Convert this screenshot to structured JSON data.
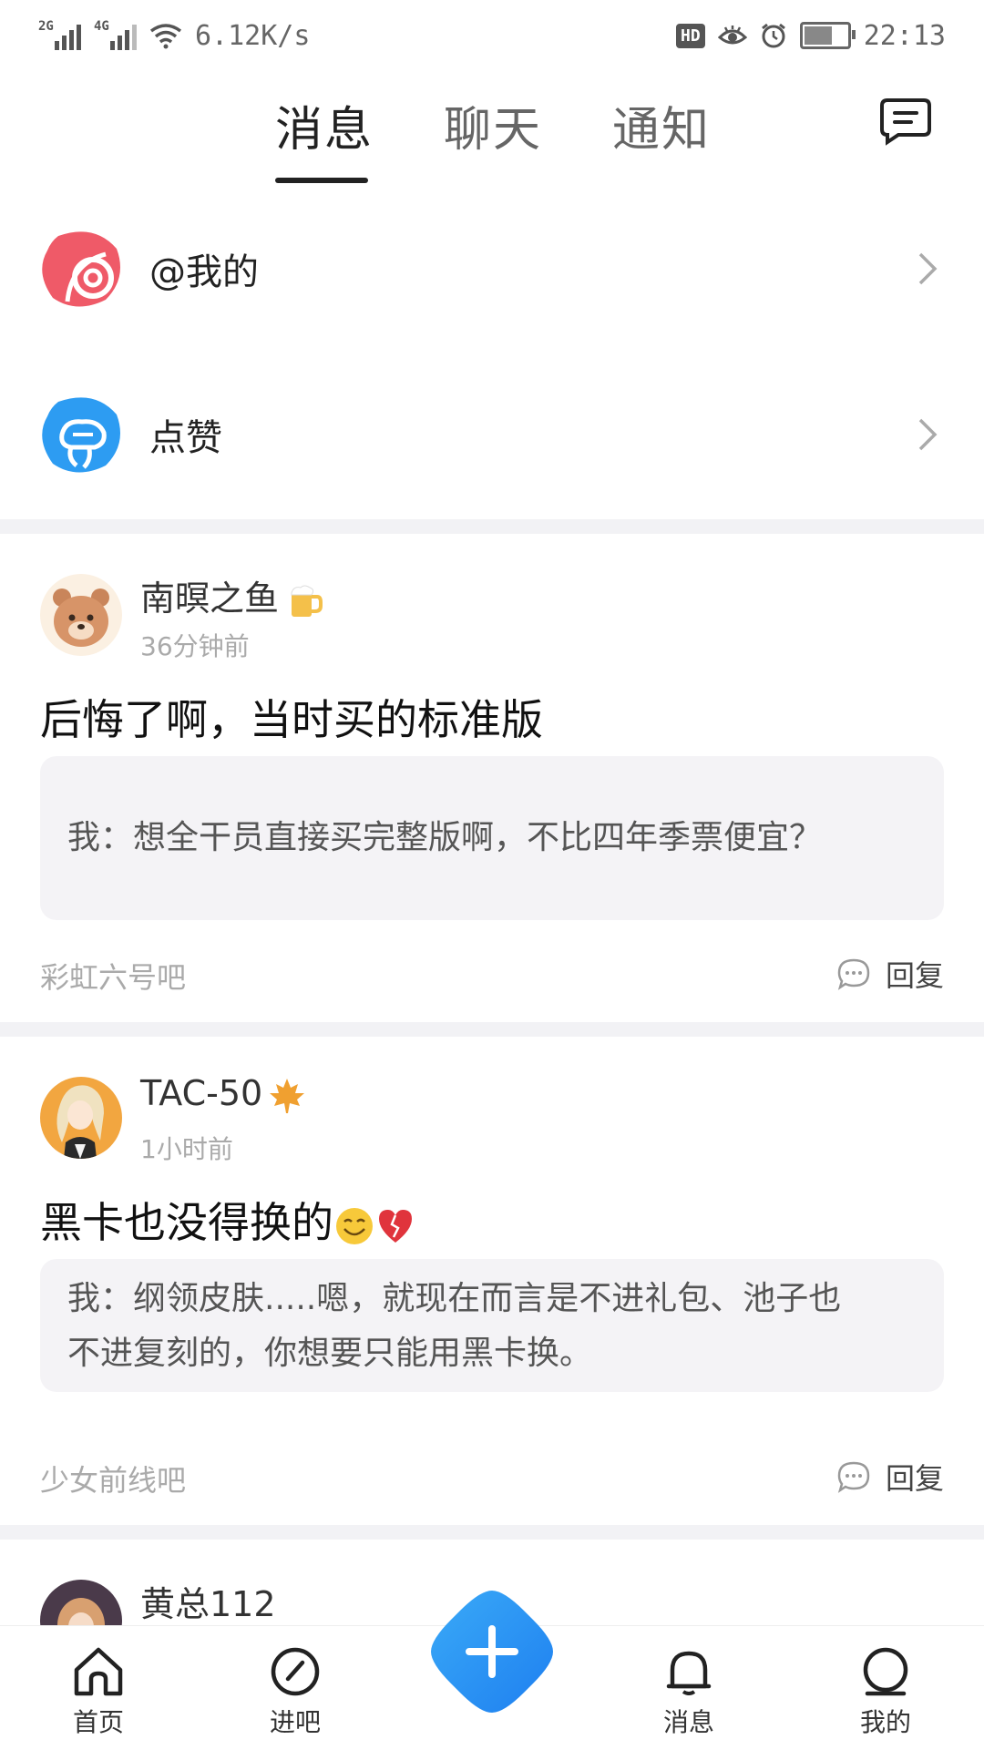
{
  "status_bar": {
    "net1": "2G",
    "net2": "4G",
    "speed": "6.12K/s",
    "hd": "HD",
    "time": "22:13"
  },
  "tabs": [
    {
      "label": "消息"
    },
    {
      "label": "聊天"
    },
    {
      "label": "通知"
    }
  ],
  "entries": [
    {
      "label": "@我的"
    },
    {
      "label": "点赞"
    }
  ],
  "posts": [
    {
      "user": "南暝之鱼",
      "time": "36分钟前",
      "title": "后悔了啊，当时买的标准版",
      "quote": "我：想全干员直接买完整版啊，不比四年季票便宜？",
      "forum": "彩虹六号吧",
      "reply": "回复"
    },
    {
      "user": "TAC-50",
      "time": "1小时前",
      "title": "黑卡也没得换的",
      "quote_line1": "我：纲领皮肤.....嗯，就现在而言是不进礼包、池子也",
      "quote_line2": "不进复刻的，你想要只能用黑卡换。",
      "forum": "少女前线吧",
      "reply": "回复"
    },
    {
      "user": "黄总112"
    }
  ],
  "bottom_nav": [
    {
      "label": "首页"
    },
    {
      "label": "进吧"
    },
    {
      "label": "消息"
    },
    {
      "label": "我的"
    }
  ],
  "colors": {
    "accent_blue": "#2b9af3",
    "red_icon": "#ef5a68",
    "blue_icon": "#2d9cf2"
  }
}
